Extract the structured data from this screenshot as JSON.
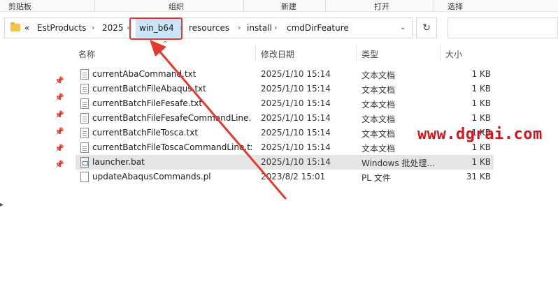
{
  "ribbon": {
    "groups": [
      "剪贴板",
      "组织",
      "新建",
      "打开",
      "选择"
    ]
  },
  "address": {
    "overflow": "«",
    "crumbs": [
      "EstProducts",
      "2025",
      "win_b64",
      "resources",
      "install",
      "cmdDirFeature"
    ],
    "highlighted_crumb": "win_b64"
  },
  "columns": {
    "name": "名称",
    "date": "修改日期",
    "type": "类型",
    "size": "大小"
  },
  "files": [
    {
      "name": "currentAbaCommand.txt",
      "date": "2025/1/10 15:14",
      "type": "文本文档",
      "size": "1 KB",
      "icon": "text-file-icon"
    },
    {
      "name": "currentBatchFileAbaqus.txt",
      "date": "2025/1/10 15:14",
      "type": "文本文档",
      "size": "1 KB",
      "icon": "text-file-icon"
    },
    {
      "name": "currentBatchFileFesafe.txt",
      "date": "2025/1/10 15:14",
      "type": "文本文档",
      "size": "1 KB",
      "icon": "text-file-icon"
    },
    {
      "name": "currentBatchFileFesafeCommandLine....",
      "date": "2025/1/10 15:14",
      "type": "文本文档",
      "size": "1 KB",
      "icon": "text-file-icon"
    },
    {
      "name": "currentBatchFileTosca.txt",
      "date": "2025/1/10 15:14",
      "type": "文本文档",
      "size": "1 KB",
      "icon": "text-file-icon"
    },
    {
      "name": "currentBatchFileToscaCommandLine.txt",
      "date": "2025/1/10 15:14",
      "type": "文本文档",
      "size": "1 KB",
      "icon": "text-file-icon"
    },
    {
      "name": "launcher.bat",
      "date": "2025/1/10 15:14",
      "type": "Windows 批处理...",
      "size": "1 KB",
      "icon": "batch-file-icon",
      "selected": true
    },
    {
      "name": "updateAbaqusCommands.pl",
      "date": "2023/8/2 15:01",
      "type": "PL 文件",
      "size": "31 KB",
      "icon": "pl-file-icon"
    }
  ],
  "watermark": "www.dgrai.com",
  "colors": {
    "annotation_red": "#e23a2e",
    "crumb_highlight": "#cce4f7",
    "selected_row": "#e5e5e5",
    "watermark": "#d4161c"
  }
}
